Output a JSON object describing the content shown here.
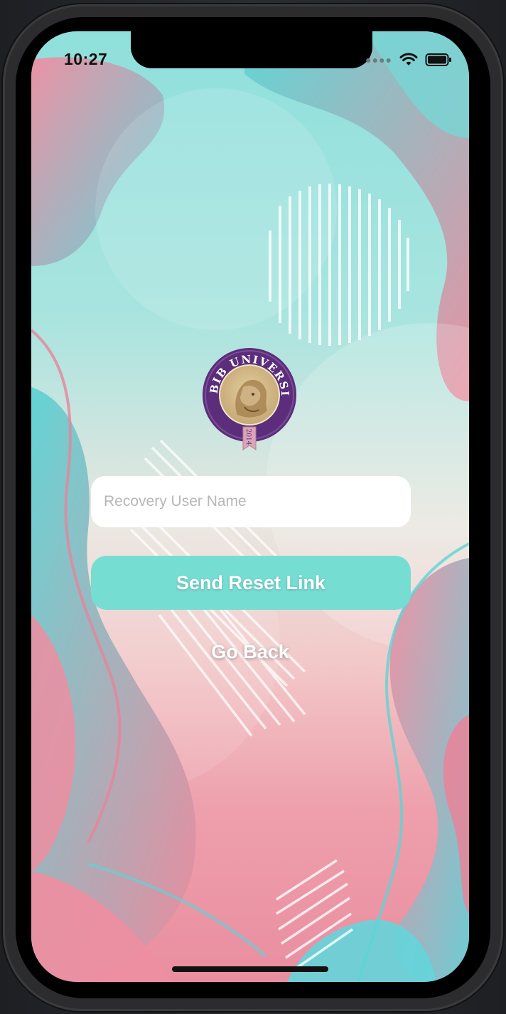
{
  "status_bar": {
    "time": "10:27",
    "signal_icon": "cellular-dots-icon",
    "wifi_icon": "wifi-icon",
    "battery_icon": "battery-icon"
  },
  "logo": {
    "arc_text": "HABIB UNIVERSITY",
    "year": "2014",
    "colors": {
      "ring": "#5b2d7a",
      "inner": "#cdb283",
      "ribbon": "#d8a6b8"
    }
  },
  "form": {
    "username_placeholder": "Recovery User Name",
    "username_value": "",
    "send_label": "Send Reset Link",
    "back_label": "Go Back"
  },
  "theme": {
    "accent": "#76ddd3",
    "teal": "#5fd3d4",
    "pink": "#ec8a9d"
  }
}
